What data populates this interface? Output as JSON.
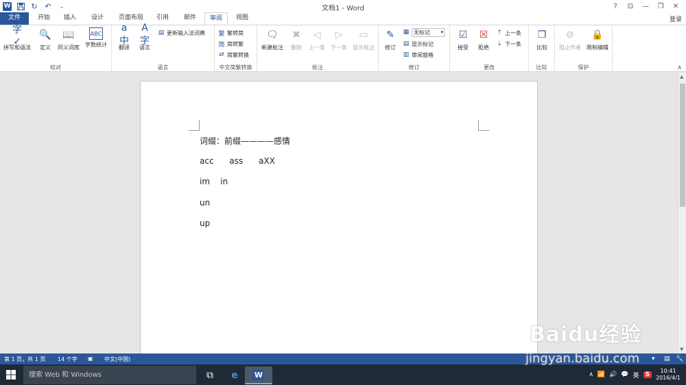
{
  "window": {
    "title": "文档1 - Word",
    "help": "?",
    "restore_ribbon": "⊡",
    "minimize": "—",
    "maximize": "❐",
    "close": "✕"
  },
  "qat": {
    "undo": "↶",
    "redo_menu": "⌄"
  },
  "tabs": [
    "文件",
    "开始",
    "插入",
    "设计",
    "页面布局",
    "引用",
    "邮件",
    "审阅",
    "视图"
  ],
  "active_tab": "审阅",
  "login": "登录",
  "ribbon": {
    "groups": {
      "proofing": {
        "label": "校对",
        "buttons": [
          "拼写和语法",
          "定义",
          "同义词库",
          "字数统计"
        ]
      },
      "language": {
        "label": "语言",
        "translate": "翻译",
        "language": "语言",
        "update_ime": "更新输入法词典"
      },
      "chinese": {
        "label": "中文简繁转换",
        "t2s": "繁转简",
        "s2t": "简转繁",
        "convert": "简繁转换"
      },
      "comments": {
        "label": "批注",
        "new": "新建批注",
        "delete": "删除",
        "prev": "上一条",
        "next": "下一条",
        "show": "显示批注"
      },
      "tracking": {
        "label": "修订",
        "track": "修订",
        "markup_combo": "无标记",
        "show_markup": "显示标记",
        "review_pane": "审阅窗格"
      },
      "changes": {
        "label": "更改",
        "accept": "接受",
        "reject": "拒绝",
        "prev": "上一条",
        "next": "下一条"
      },
      "compare": {
        "label": "比较",
        "compare": "比较"
      },
      "protect": {
        "label": "保护",
        "block": "阻止作者",
        "restrict": "限制编辑"
      }
    }
  },
  "document": {
    "lines": [
      "词缀：前缀————感情",
      "acc      ass      aXX",
      "im    in",
      "un",
      "up"
    ]
  },
  "status": {
    "page": "第 1 页，共 1 页",
    "words": "14 个字",
    "language": "中文(中国)"
  },
  "taskbar": {
    "search_placeholder": "搜索 Web 和 Windows",
    "ime": "英",
    "time": "10:41",
    "date": "2016/4/1"
  },
  "watermark": {
    "brand": "Baidu经验",
    "url": "jingyan.baidu.com"
  }
}
